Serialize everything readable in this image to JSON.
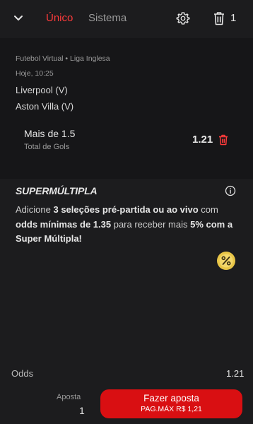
{
  "header": {
    "tabs": [
      {
        "label": "Único",
        "active": true
      },
      {
        "label": "Sistema",
        "active": false
      }
    ],
    "selection_count": "1",
    "icons": [
      "chevron-down-icon",
      "gear-icon",
      "trash-icon"
    ]
  },
  "event": {
    "league": "Futebol Virtual • Liga Inglesa",
    "time": "Hoje, 10:25",
    "home_team": "Liverpool (V)",
    "away_team": "Aston Villa (V)",
    "market": "Mais de 1.5",
    "submarket": "Total de Gols",
    "odd": "1.21"
  },
  "supermultipla": {
    "title": "SUPERMÚLTIPLA",
    "text_parts": [
      "Adicione ",
      "3 seleções pré-partida ou ao vivo",
      " com ",
      "odds mínimas de 1.35",
      " para receber mais ",
      "5% com a Super Múltipla!"
    ]
  },
  "footer": {
    "odds_label": "Odds",
    "odds_value": "1.21",
    "bet_label": "Aposta",
    "bet_value": "1",
    "button_label": "Fazer aposta",
    "button_sub": "PAG.MÁX R$ 1,21"
  },
  "colors": {
    "accent": "#d90f12",
    "active_tab": "#ff3b3b",
    "background": "#1c1c1e",
    "card": "#161618",
    "badge": "#e8c547"
  }
}
